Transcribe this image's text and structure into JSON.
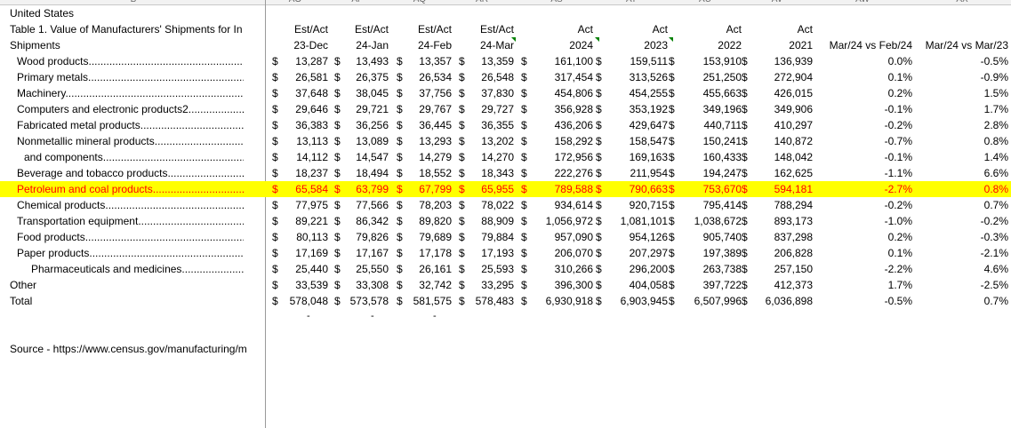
{
  "column_letters": [
    "B",
    "AO",
    "AP",
    "AQ",
    "AR",
    "AS",
    "AT",
    "AU",
    "AV",
    "AW",
    "AX"
  ],
  "header": {
    "country": "United States",
    "table_title": "Table 1.  Value of Manufacturers' Shipments for In",
    "row_label": "Shipments",
    "col_type": [
      "Est/Act",
      "Est/Act",
      "Est/Act",
      "Est/Act",
      "Act",
      "Act",
      "Act",
      "Act"
    ],
    "col_period": [
      "23-Dec",
      "24-Jan",
      "24-Feb",
      "24-Mar",
      "2024",
      "2023",
      "2022",
      "2021"
    ],
    "change_labels": [
      "Mar/24 vs Feb/24",
      "Mar/24 vs Mar/23"
    ]
  },
  "rows": [
    {
      "label": "Wood products",
      "indent": 1,
      "dots": true,
      "values": [
        "13,287",
        "13,493",
        "13,357",
        "13,359",
        "161,100",
        "159,511",
        "153,910",
        "136,939"
      ],
      "changes": [
        "0.0%",
        "-0.5%"
      ],
      "highlight": false
    },
    {
      "label": "Primary metals",
      "indent": 1,
      "dots": true,
      "values": [
        "26,581",
        "26,375",
        "26,534",
        "26,548",
        "317,454",
        "313,526",
        "251,250",
        "272,904"
      ],
      "changes": [
        "0.1%",
        "-0.9%"
      ],
      "highlight": false
    },
    {
      "label": "Machinery",
      "indent": 1,
      "dots": true,
      "values": [
        "37,648",
        "38,045",
        "37,756",
        "37,830",
        "454,806",
        "454,255",
        "455,663",
        "426,015"
      ],
      "changes": [
        "0.2%",
        "1.5%"
      ],
      "highlight": false
    },
    {
      "label": "Computers and electronic products2",
      "indent": 1,
      "dots": true,
      "values": [
        "29,646",
        "29,721",
        "29,767",
        "29,727",
        "356,928",
        "353,192",
        "349,196",
        "349,906"
      ],
      "changes": [
        "-0.1%",
        "1.7%"
      ],
      "highlight": false
    },
    {
      "label": "Fabricated metal products",
      "indent": 1,
      "dots": true,
      "values": [
        "36,383",
        "36,256",
        "36,445",
        "36,355",
        "436,206",
        "429,647",
        "440,711",
        "410,297"
      ],
      "changes": [
        "-0.2%",
        "2.8%"
      ],
      "highlight": false
    },
    {
      "label": "Nonmetallic mineral products",
      "indent": 1,
      "dots": true,
      "values": [
        "13,113",
        "13,089",
        "13,293",
        "13,202",
        "158,292",
        "158,547",
        "150,241",
        "140,872"
      ],
      "changes": [
        "-0.7%",
        "0.8%"
      ],
      "highlight": false
    },
    {
      "label": "and components",
      "indent": 2,
      "dots": true,
      "values": [
        "14,112",
        "14,547",
        "14,279",
        "14,270",
        "172,956",
        "169,163",
        "160,433",
        "148,042"
      ],
      "changes": [
        "-0.1%",
        "1.4%"
      ],
      "highlight": false
    },
    {
      "label": "Beverage and tobacco products",
      "indent": 1,
      "dots": true,
      "values": [
        "18,237",
        "18,494",
        "18,552",
        "18,343",
        "222,276",
        "211,954",
        "194,247",
        "162,625"
      ],
      "changes": [
        "-1.1%",
        "6.6%"
      ],
      "highlight": false
    },
    {
      "label": "Petroleum and coal products",
      "indent": 1,
      "dots": true,
      "values": [
        "65,584",
        "63,799",
        "67,799",
        "65,955",
        "789,588",
        "790,663",
        "753,670",
        "594,181"
      ],
      "changes": [
        "-2.7%",
        "0.8%"
      ],
      "highlight": true
    },
    {
      "label": "Chemical products",
      "indent": 1,
      "dots": true,
      "values": [
        "77,975",
        "77,566",
        "78,203",
        "78,022",
        "934,614",
        "920,715",
        "795,414",
        "788,294"
      ],
      "changes": [
        "-0.2%",
        "0.7%"
      ],
      "highlight": false
    },
    {
      "label": "Transportation equipment",
      "indent": 1,
      "dots": true,
      "values": [
        "89,221",
        "86,342",
        "89,820",
        "88,909",
        "1,056,972",
        "1,081,101",
        "1,038,672",
        "893,173"
      ],
      "changes": [
        "-1.0%",
        "-0.2%"
      ],
      "highlight": false
    },
    {
      "label": "Food products",
      "indent": 1,
      "dots": true,
      "values": [
        "80,113",
        "79,826",
        "79,689",
        "79,884",
        "957,090",
        "954,126",
        "905,740",
        "837,298"
      ],
      "changes": [
        "0.2%",
        "-0.3%"
      ],
      "highlight": false
    },
    {
      "label": "Paper products",
      "indent": 1,
      "dots": true,
      "values": [
        "17,169",
        "17,167",
        "17,178",
        "17,193",
        "206,070",
        "207,297",
        "197,389",
        "206,828"
      ],
      "changes": [
        "0.1%",
        "-2.1%"
      ],
      "highlight": false
    },
    {
      "label": "Pharmaceuticals and medicines",
      "indent": 3,
      "dots": true,
      "values": [
        "25,440",
        "25,550",
        "26,161",
        "25,593",
        "310,266",
        "296,200",
        "263,738",
        "257,150"
      ],
      "changes": [
        "-2.2%",
        "4.6%"
      ],
      "highlight": false
    },
    {
      "label": "Other",
      "indent": 0,
      "dots": false,
      "values": [
        "33,539",
        "33,308",
        "32,742",
        "33,295",
        "396,300",
        "404,058",
        "397,722",
        "412,373"
      ],
      "changes": [
        "1.7%",
        "-2.5%"
      ],
      "highlight": false
    },
    {
      "label": "Total",
      "indent": 0,
      "dots": false,
      "values": [
        "578,048",
        "573,578",
        "581,575",
        "578,483",
        "6,930,918",
        "6,903,945",
        "6,507,996",
        "6,036,898"
      ],
      "changes": [
        "-0.5%",
        "0.7%"
      ],
      "highlight": false
    }
  ],
  "currency_symbol": "$",
  "dash_mark": "-",
  "dots_text": "..................................................................",
  "source": "Source - https://www.census.gov/manufacturing/m",
  "colors": {
    "highlight_fill": "#ffff00",
    "highlight_text": "#ff0000",
    "comment_marker": "#008000"
  }
}
